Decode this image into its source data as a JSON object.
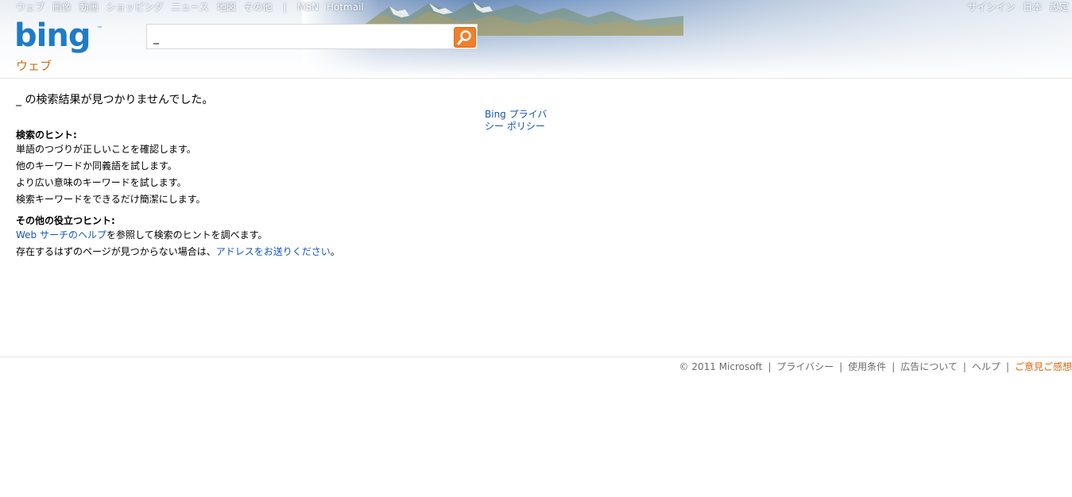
{
  "topnav": {
    "items": [
      "ウェブ",
      "画像",
      "動画",
      "ショッピング",
      "ニュース",
      "地図",
      "その他"
    ],
    "separator": "|",
    "extra": [
      "MSN",
      "Hotmail"
    ]
  },
  "topright": {
    "signin": "サインイン",
    "region": "日本",
    "settings": "設定"
  },
  "search": {
    "query": "_",
    "icon": "search-icon"
  },
  "scope": "ウェブ",
  "results": {
    "no_results": "_ の検索結果が見つかりませんでした。",
    "tips_heading": "検索のヒント:",
    "tips": [
      "単語のつづりが正しいことを確認します。",
      "他のキーワードか同義語を試します。",
      "より広い意味のキーワードを試します。",
      "検索キーワードをできるだけ簡潔にします。"
    ],
    "other_heading": "その他の役立つヒント:",
    "help_link": "Web サーチのヘルプ",
    "help_suffix": "を参照して検索のヒントを調べます。",
    "missing_prefix": "存在するはずのページが見つからない場合は、",
    "missing_link": "アドレスをお送りください",
    "missing_suffix": "。"
  },
  "side": {
    "privacy": "Bing プライバシー ポリシー"
  },
  "footer": {
    "copyright": "© 2011 Microsoft",
    "links": [
      "プライバシー",
      "使用条件",
      "広告について",
      "ヘルプ"
    ],
    "feedback": "ご意見ご感想"
  },
  "colors": {
    "accent_orange": "#f07f2a",
    "link_blue": "#1355b4",
    "scope_orange": "#d3690f",
    "logo_blue": "#1f7bc5"
  }
}
